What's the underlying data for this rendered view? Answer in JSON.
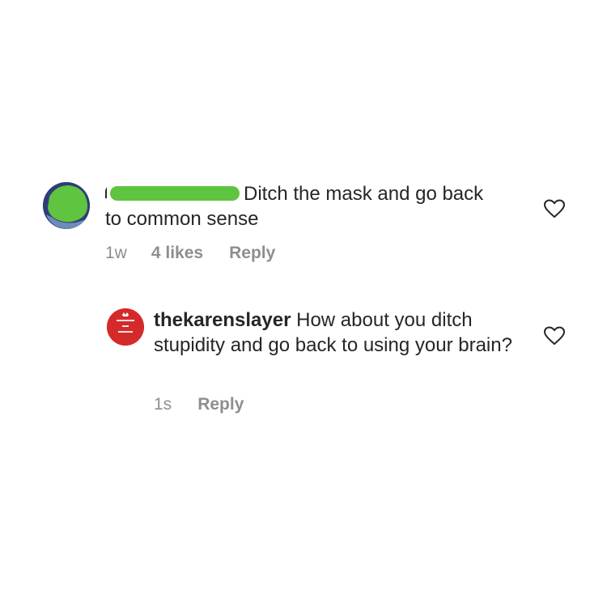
{
  "comments": [
    {
      "text": "Ditch the mask and go back to common sense",
      "time": "1w",
      "likes": "4 likes",
      "reply": "Reply"
    },
    {
      "username": "thekarenslayer",
      "text": "How about you ditch stupidity and go back to using your brain?",
      "time": "1s",
      "reply": "Reply"
    }
  ],
  "colors": {
    "text": "#262626",
    "meta": "#8e8e8e",
    "redaction": "#5fc43f",
    "avatar_red": "#d42a2a"
  },
  "icons": [
    "heart-outline-icon"
  ]
}
